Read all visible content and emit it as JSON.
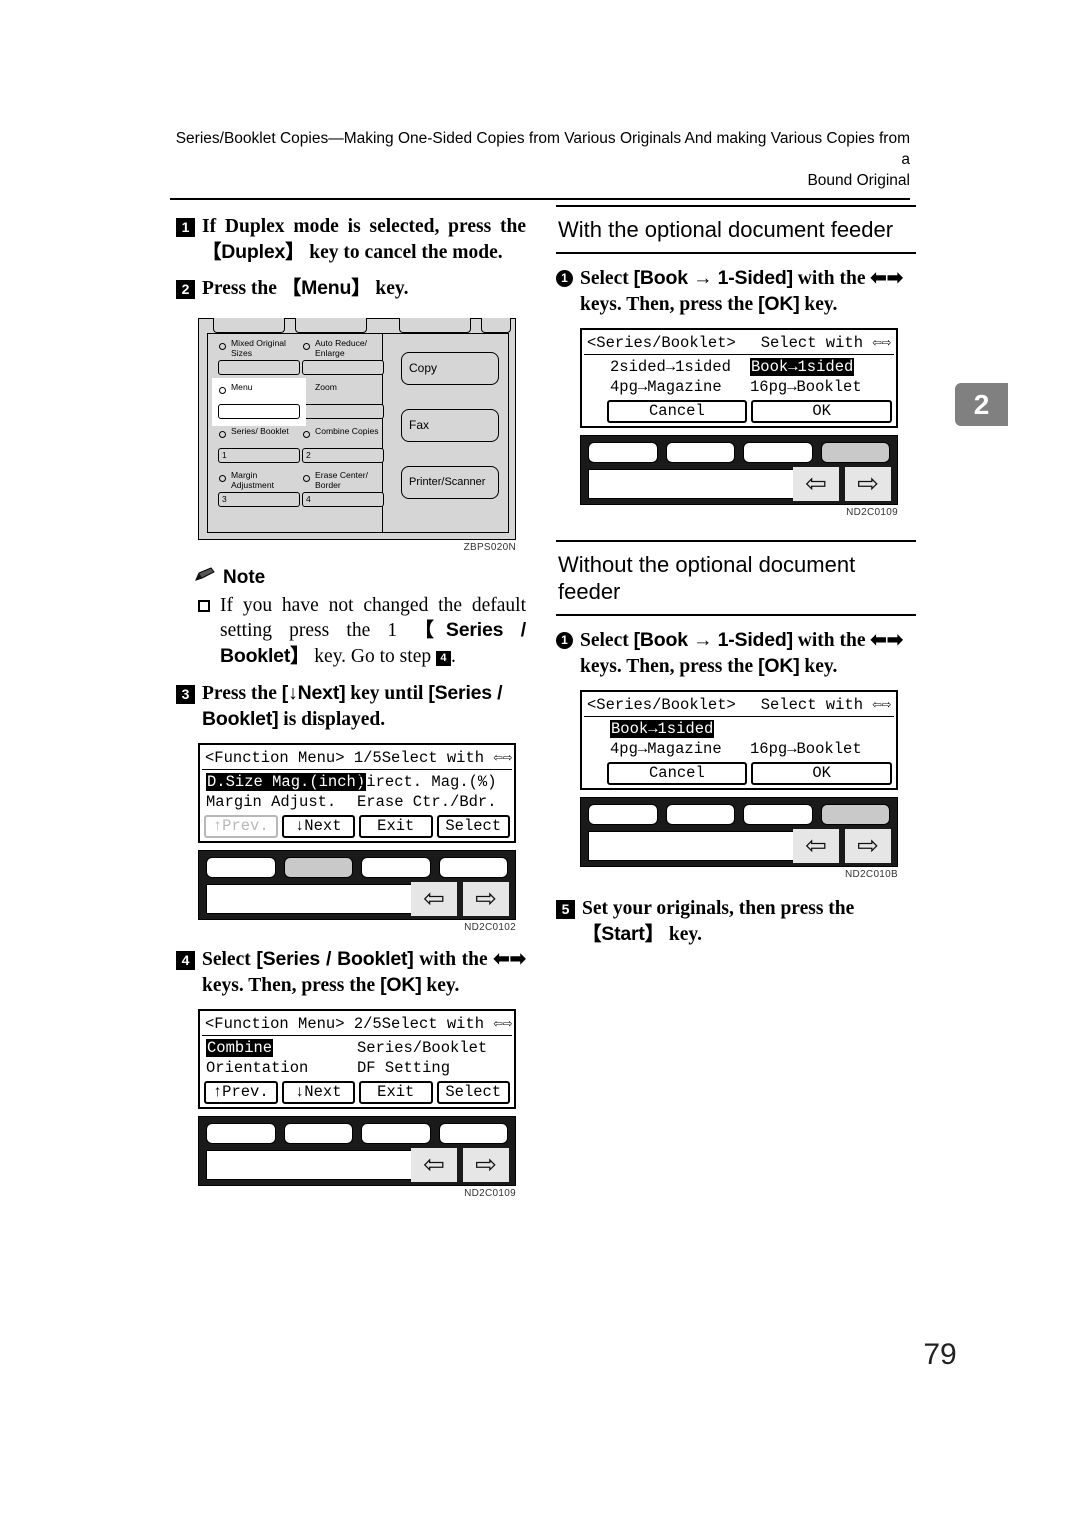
{
  "header": {
    "line1": "Series/Booklet Copies—Making One-Sided Copies from Various Originals And making Various Copies from a",
    "line2": "Bound Original"
  },
  "chapter_tab": "2",
  "page_number": "79",
  "left_column": {
    "step1": {
      "num": "1",
      "text_a": "If Duplex mode is selected, press the ",
      "key": "【Duplex】",
      "text_b": " key to cancel the mode."
    },
    "step2": {
      "num": "2",
      "text_a": "Press the ",
      "key": "【Menu】",
      "text_b": " key."
    },
    "control_panel": {
      "figure_code": "ZBPS020N",
      "keys": [
        {
          "label": "Mixed Original Sizes",
          "number": ""
        },
        {
          "label": "Auto Reduce/ Enlarge",
          "number": ""
        },
        {
          "label": "Menu",
          "number": ""
        },
        {
          "label": "Zoom",
          "number": ""
        },
        {
          "label": "Series/ Booklet",
          "number": "1"
        },
        {
          "label": "Combine Copies",
          "number": "2"
        },
        {
          "label": "Margin Adjustment",
          "number": "3"
        },
        {
          "label": "Erase Center/ Border",
          "number": "4"
        }
      ],
      "mode_buttons": [
        "Copy",
        "Fax",
        "Printer/Scanner"
      ]
    },
    "note": {
      "title": "Note",
      "text_a": "If you have not changed the default setting press the 1 ",
      "key": "【Series / Booklet】",
      "text_b": " key. Go to step ",
      "step_ref": "4",
      "text_c": "."
    },
    "step3": {
      "num": "3",
      "text_a": "Press the ",
      "key1": "[↓Next]",
      "text_b": " key until ",
      "key2": "[Series / Booklet]",
      "text_c": " is displayed."
    },
    "lcd1": {
      "title": "<Function Menu> 1/5",
      "hint": "Select with",
      "rows": [
        {
          "left": "D.Size Mag.(inch)",
          "left_selected": true,
          "right": "Direct. Mag.(%)",
          "right_selected": false
        },
        {
          "left": "Margin Adjust.",
          "left_selected": false,
          "right": "Erase Ctr./Bdr.",
          "right_selected": false
        }
      ],
      "buttons": [
        "↑Prev.",
        "↓Next",
        "Exit",
        "Select"
      ],
      "prev_disabled": true
    },
    "keypad1": {
      "highlight_index": 1,
      "figure_code": "ND2C0102"
    },
    "step4": {
      "num": "4",
      "text_a": "Select ",
      "key1": "[Series / Booklet]",
      "text_b": " with the ",
      "arrows": "⬅➡",
      "text_c": " keys. Then, press the ",
      "key2": "[OK]",
      "text_d": " key."
    },
    "lcd2": {
      "title": "<Function Menu> 2/5",
      "hint": "Select with",
      "rows": [
        {
          "left": "Combine",
          "left_selected": true,
          "right": "Series/Booklet",
          "right_selected": false
        },
        {
          "left": "Orientation",
          "left_selected": false,
          "right": "DF Setting",
          "right_selected": false
        }
      ],
      "buttons": [
        "↑Prev.",
        "↓Next",
        "Exit",
        "Select"
      ],
      "prev_disabled": false
    },
    "keypad2": {
      "highlight_index": -1,
      "figure_code": "ND2C0109"
    }
  },
  "right_column": {
    "section1": {
      "title": "With the optional document feeder",
      "step": {
        "num": "1",
        "text_a": "Select ",
        "key1": "[Book → 1-Sided]",
        "text_b": " with the ",
        "arrows": "⬅➡",
        "text_c": " keys. Then, press the ",
        "key2": "[OK]",
        "text_d": " key."
      },
      "lcd": {
        "title": "<Series/Booklet>",
        "hint": "Select with",
        "rows": [
          {
            "left": "2sided→1sided",
            "left_selected": false,
            "right": "Book→1sided",
            "right_selected": true
          },
          {
            "left": "4pg→Magazine",
            "left_selected": false,
            "right": "16pg→Booklet",
            "right_selected": false
          }
        ],
        "buttons": [
          "Cancel",
          "OK"
        ]
      },
      "keypad": {
        "highlight_index": 3,
        "figure_code": "ND2C0109"
      }
    },
    "section2": {
      "title": "Without the optional document feeder",
      "step": {
        "num": "1",
        "text_a": "Select ",
        "key1": "[Book → 1-Sided]",
        "text_b": " with the ",
        "arrows": "⬅➡",
        "text_c": " keys. Then, press the ",
        "key2": "[OK]",
        "text_d": " key."
      },
      "lcd": {
        "title": "<Series/Booklet>",
        "hint": "Select with",
        "rows": [
          {
            "left": "Book→1sided",
            "left_selected": true,
            "right": "",
            "right_selected": false
          },
          {
            "left": "4pg→Magazine",
            "left_selected": false,
            "right": "16pg→Booklet",
            "right_selected": false
          }
        ],
        "buttons": [
          "Cancel",
          "OK"
        ]
      },
      "keypad": {
        "highlight_index": 3,
        "figure_code": "ND2C010B"
      }
    },
    "step5": {
      "num": "5",
      "text_a": "Set your originals, then press the ",
      "key": "【Start】",
      "text_b": " key."
    }
  }
}
